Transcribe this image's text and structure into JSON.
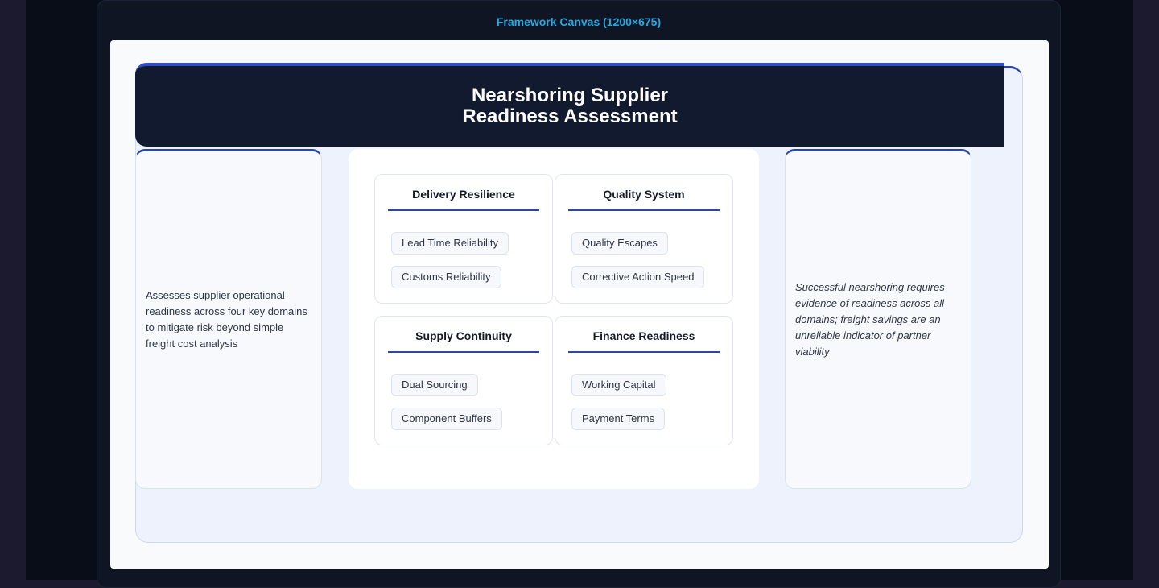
{
  "canvas_label": "Framework Canvas (1200×675)",
  "title": {
    "line1": "Nearshoring Supplier",
    "line2": "Readiness Assessment"
  },
  "left_note": "Assesses supplier operational readiness across four key domains to mitigate risk beyond simple freight cost analysis",
  "right_note": "Successful nearshoring requires evidence of readiness across all domains; freight savings are an unreliable indicator of partner viability",
  "domains": [
    {
      "title": "Delivery Resilience",
      "items": [
        "Lead Time Reliability",
        "Customs Reliability"
      ]
    },
    {
      "title": "Quality System",
      "items": [
        "Quality Escapes",
        "Corrective Action Speed"
      ]
    },
    {
      "title": "Supply Continuity",
      "items": [
        "Dual Sourcing",
        "Component Buffers"
      ]
    },
    {
      "title": "Finance Readiness",
      "items": [
        "Working Capital",
        "Payment Terms"
      ]
    }
  ],
  "colors": {
    "accent": "#2b45a8",
    "label": "#27a8e0",
    "title_band": "#111a2e"
  }
}
